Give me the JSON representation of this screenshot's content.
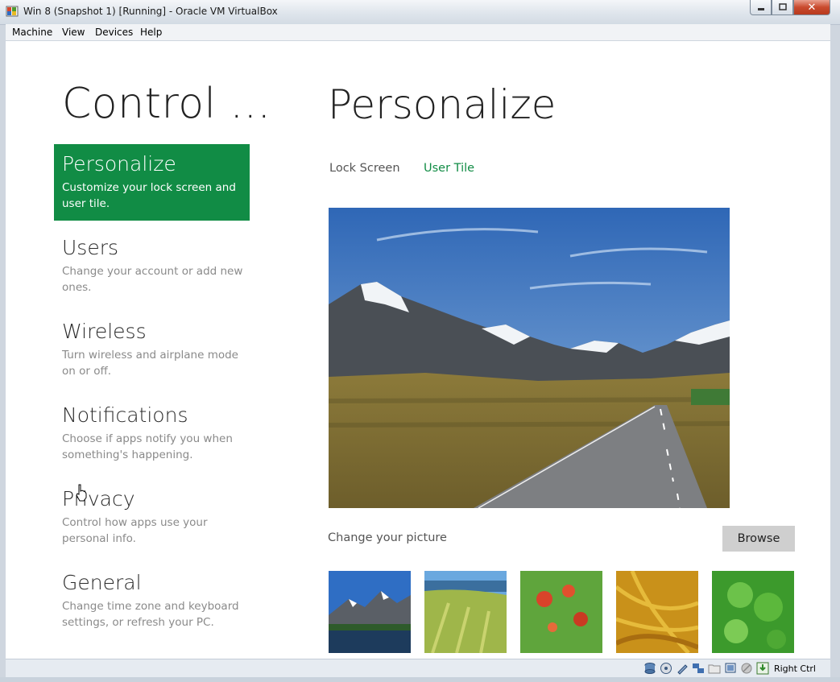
{
  "window": {
    "title": "Win 8 (Snapshot 1) [Running] - Oracle VM VirtualBox",
    "close_glyph": "✕"
  },
  "menubar": {
    "items": [
      "Machine",
      "View",
      "Devices",
      "Help"
    ]
  },
  "sidebar": {
    "title": "Control ...",
    "items": [
      {
        "title": "Personalize",
        "desc": "Customize your lock screen and user tile.",
        "active": true
      },
      {
        "title": "Users",
        "desc": "Change your account or add new ones.",
        "active": false
      },
      {
        "title": "Wireless",
        "desc": "Turn wireless and airplane mode on or off.",
        "active": false
      },
      {
        "title": "Notifications",
        "desc": "Choose if apps notify you when something's happening.",
        "active": false
      },
      {
        "title": "Privacy",
        "desc": "Control how apps use your personal info.",
        "active": false
      },
      {
        "title": "General",
        "desc": "Change time zone and keyboard settings, or refresh your PC.",
        "active": false
      }
    ]
  },
  "main": {
    "title": "Personalize",
    "tabs": [
      {
        "label": "Lock Screen",
        "selected": false
      },
      {
        "label": "User Tile",
        "selected": true
      }
    ],
    "change_picture_label": "Change your picture",
    "browse_label": "Browse"
  },
  "statusbar": {
    "host_key": "Right Ctrl",
    "icons": [
      "hard-disk-icon",
      "optical-drive-icon",
      "usb-icon",
      "network-icon",
      "shared-folder-icon",
      "display-icon",
      "mouse-integration-icon",
      "host-key-icon"
    ]
  },
  "colors": {
    "accent": "#118c45",
    "button": "#cfcfcf"
  }
}
